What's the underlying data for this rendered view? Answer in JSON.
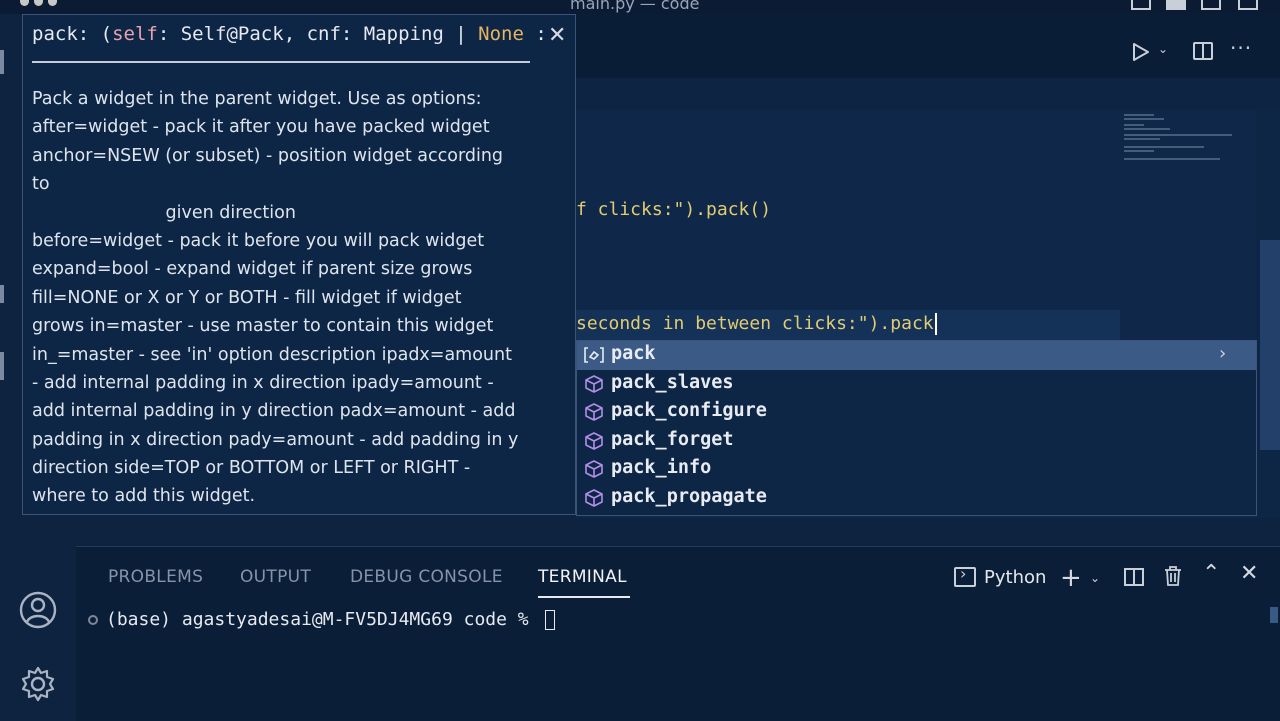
{
  "window": {
    "title": "main.py — code"
  },
  "editor": {
    "line_top": "f clicks:\").pack()",
    "line_current_prefix": "seconds in between clicks:\").pack"
  },
  "hover": {
    "signature": {
      "name": "pack",
      "open": ": (",
      "self": "self",
      "self_type": ": Self@Pack, cnf: Mapping | ",
      "none": "None",
      "tail": " :"
    },
    "doc_lines": [
      "Pack a widget in the parent widget. Use as options:",
      "after=widget - pack it after you have packed widget",
      "anchor=NSEW (or subset) - position widget according",
      "to",
      "                        given direction",
      "before=widget - pack it before you will pack widget",
      "expand=bool - expand widget if parent size grows",
      "fill=NONE or X or Y or BOTH - fill widget if widget",
      "grows in=master - use master to contain this widget",
      "in_=master - see 'in' option description ipadx=amount",
      "- add internal padding in x direction ipady=amount -",
      "add internal padding in y direction padx=amount - add",
      "padding in x direction pady=amount - add padding in y",
      "direction side=TOP or BOTTOM or LEFT or RIGHT -",
      "where to add this widget."
    ]
  },
  "suggest": {
    "items": [
      {
        "label": "pack",
        "icon": "variable-icon",
        "selected": true
      },
      {
        "label": "pack_slaves",
        "icon": "method-cube-icon"
      },
      {
        "label": "pack_configure",
        "icon": "method-cube-icon"
      },
      {
        "label": "pack_forget",
        "icon": "method-cube-icon"
      },
      {
        "label": "pack_info",
        "icon": "method-cube-icon"
      },
      {
        "label": "pack_propagate",
        "icon": "method-cube-icon"
      }
    ]
  },
  "panel": {
    "tabs": [
      "PROBLEMS",
      "OUTPUT",
      "DEBUG CONSOLE",
      "TERMINAL"
    ],
    "active_tab": "TERMINAL",
    "terminal_shell": "Python",
    "terminal_prompt": "(base) agastyadesai@M-FV5DJ4MG69 code % "
  },
  "colors": {
    "background": "#0d2340",
    "selection": "#3b5a86",
    "keyword": "#e9a25b",
    "string": "#e2cc73"
  }
}
